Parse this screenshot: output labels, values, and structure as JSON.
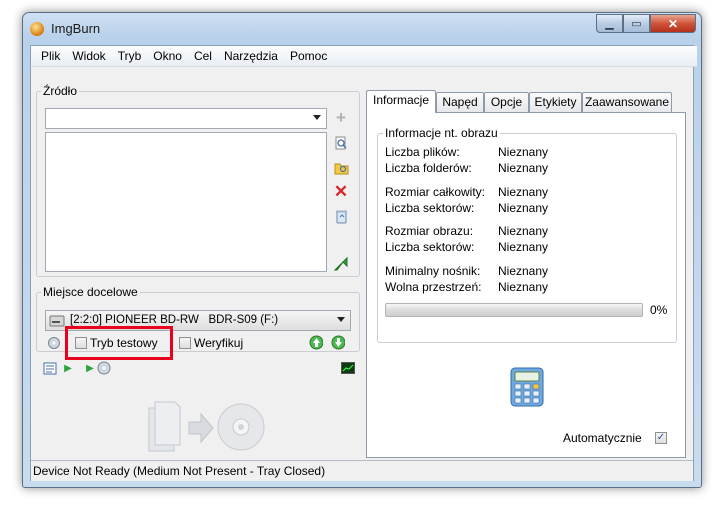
{
  "window": {
    "title": "ImgBurn"
  },
  "menu": [
    "Plik",
    "Widok",
    "Tryb",
    "Okno",
    "Cel",
    "Narzędzia",
    "Pomoc"
  ],
  "source": {
    "label": "Źródło",
    "value": ""
  },
  "destination": {
    "label": "Miejsce docelowe",
    "drive": "[2:2:0] PIONEER BD-RW   BDR-S09 (F:)",
    "test_mode_label": "Tryb testowy",
    "test_mode_checked": false,
    "verify_label": "Weryfikuj",
    "verify_checked": false
  },
  "tabs": [
    "Informacje",
    "Napęd",
    "Opcje",
    "Etykiety",
    "Zaawansowane"
  ],
  "active_tab": "Informacje",
  "info": {
    "group_title": "Informacje nt. obrazu",
    "rows": [
      {
        "label": "Liczba plików:",
        "value": "Nieznany"
      },
      {
        "label": "Liczba folderów:",
        "value": "Nieznany"
      },
      {
        "label": "Rozmiar całkowity:",
        "value": "Nieznany"
      },
      {
        "label": "Liczba sektorów:",
        "value": "Nieznany"
      },
      {
        "label": "Rozmiar obrazu:",
        "value": "Nieznany"
      },
      {
        "label": "Liczba sektorów:",
        "value": "Nieznany"
      },
      {
        "label": "Minimalny nośnik:",
        "value": "Nieznany"
      },
      {
        "label": "Wolna przestrzeń:",
        "value": "Nieznany"
      }
    ],
    "progress_text": "0%",
    "progress_value": 0,
    "auto_label": "Automatycznie",
    "auto_checked": true
  },
  "status": {
    "text": "Device Not Ready (Medium Not Present - Tray Closed)"
  },
  "icons": {
    "add": "plus-icon",
    "browse_file": "search-file-icon",
    "browse_folder": "search-folder-icon",
    "remove": "red-x-icon",
    "clear": "recycle-bin-icon",
    "calculate": "green-arrow-icon"
  },
  "colors": {
    "highlight": "#e8001c",
    "progress": "#37c23a"
  }
}
